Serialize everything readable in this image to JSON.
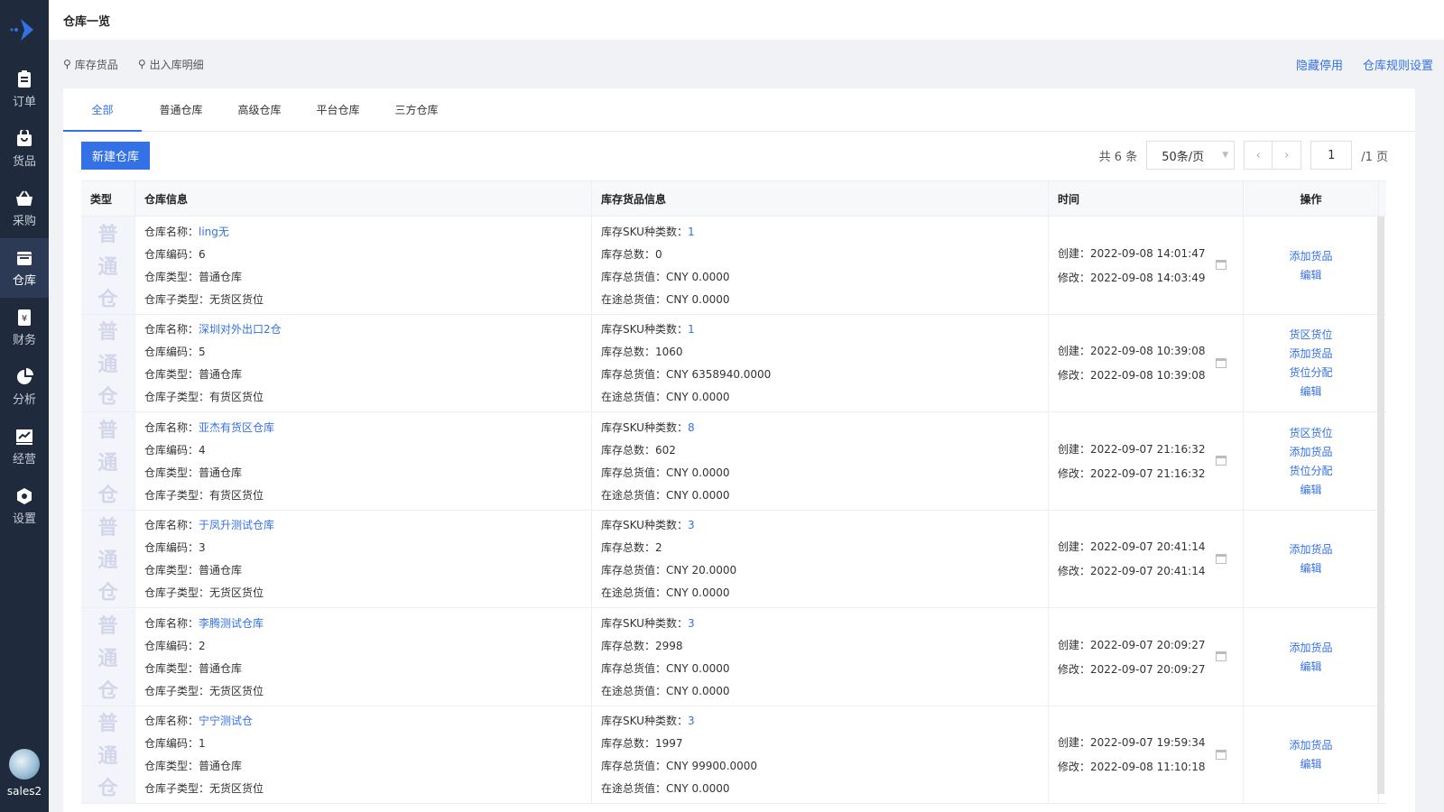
{
  "sidebar": {
    "items": [
      {
        "label": "订单",
        "icon": "order-icon"
      },
      {
        "label": "货品",
        "icon": "goods-icon"
      },
      {
        "label": "采购",
        "icon": "purchase-icon"
      },
      {
        "label": "仓库",
        "icon": "warehouse-icon",
        "active": true
      },
      {
        "label": "财务",
        "icon": "finance-icon"
      },
      {
        "label": "分析",
        "icon": "pie-chart-icon"
      },
      {
        "label": "经营",
        "icon": "line-chart-icon"
      },
      {
        "label": "设置",
        "icon": "settings-icon"
      }
    ],
    "user": "sales2"
  },
  "header": {
    "title": "仓库一览"
  },
  "subbar": {
    "links": [
      "库存货品",
      "出入库明细"
    ],
    "right": [
      "隐藏停用",
      "仓库规则设置"
    ]
  },
  "tabs": [
    "全部",
    "普通仓库",
    "高级仓库",
    "平台仓库",
    "三方仓库"
  ],
  "toolbar": {
    "new_button": "新建仓库",
    "total": "共 6 条",
    "page_size": "50条/页",
    "page": "1",
    "page_total": "/1 页"
  },
  "table": {
    "headers": {
      "type": "类型",
      "info": "仓库信息",
      "stock": "库存货品信息",
      "time": "时间",
      "ops": "操作"
    },
    "type_chars": [
      "普",
      "通",
      "仓"
    ],
    "labels": {
      "name": "仓库名称：",
      "code": "仓库编码：",
      "kind": "仓库类型：",
      "subkind": "仓库子类型：",
      "sku": "库存SKU种类数：",
      "qty": "库存总数：",
      "value": "库存总货值：",
      "transit": "在途总货值：",
      "created": "创建：",
      "modified": "修改："
    },
    "rows": [
      {
        "name": "ling无",
        "code": "6",
        "kind": "普通仓库",
        "subkind": "无货区货位",
        "sku": "1",
        "qty": "0",
        "value": "CNY 0.0000",
        "transit": "CNY 0.0000",
        "created": "2022-09-08 14:01:47",
        "modified": "2022-09-08 14:03:49",
        "ops": [
          "添加货品",
          "编辑"
        ]
      },
      {
        "name": "深圳对外出口2仓",
        "code": "5",
        "kind": "普通仓库",
        "subkind": "有货区货位",
        "sku": "1",
        "qty": "1060",
        "value": "CNY 6358940.0000",
        "transit": "CNY 0.0000",
        "created": "2022-09-08 10:39:08",
        "modified": "2022-09-08 10:39:08",
        "ops": [
          "货区货位",
          "添加货品",
          "货位分配",
          "编辑"
        ]
      },
      {
        "name": "亚杰有货区仓库",
        "code": "4",
        "kind": "普通仓库",
        "subkind": "有货区货位",
        "sku": "8",
        "qty": "602",
        "value": "CNY 0.0000",
        "transit": "CNY 0.0000",
        "created": "2022-09-07 21:16:32",
        "modified": "2022-09-07 21:16:32",
        "ops": [
          "货区货位",
          "添加货品",
          "货位分配",
          "编辑"
        ]
      },
      {
        "name": "于凤升测试仓库",
        "code": "3",
        "kind": "普通仓库",
        "subkind": "无货区货位",
        "sku": "3",
        "qty": "2",
        "value": "CNY 20.0000",
        "transit": "CNY 0.0000",
        "created": "2022-09-07 20:41:14",
        "modified": "2022-09-07 20:41:14",
        "ops": [
          "添加货品",
          "编辑"
        ]
      },
      {
        "name": "李腾测试仓库",
        "code": "2",
        "kind": "普通仓库",
        "subkind": "无货区货位",
        "sku": "3",
        "qty": "2998",
        "value": "CNY 0.0000",
        "transit": "CNY 0.0000",
        "created": "2022-09-07 20:09:27",
        "modified": "2022-09-07 20:09:27",
        "ops": [
          "添加货品",
          "编辑"
        ]
      },
      {
        "name": "宁宁测试仓",
        "code": "1",
        "kind": "普通仓库",
        "subkind": "无货区货位",
        "sku": "3",
        "qty": "1997",
        "value": "CNY 99900.0000",
        "transit": "CNY 0.0000",
        "created": "2022-09-07 19:59:34",
        "modified": "2022-09-08 11:10:18",
        "ops": [
          "添加货品",
          "编辑"
        ]
      }
    ]
  },
  "colors": {
    "accent": "#3471e6",
    "sidebar_bg": "#1f2a3d"
  }
}
